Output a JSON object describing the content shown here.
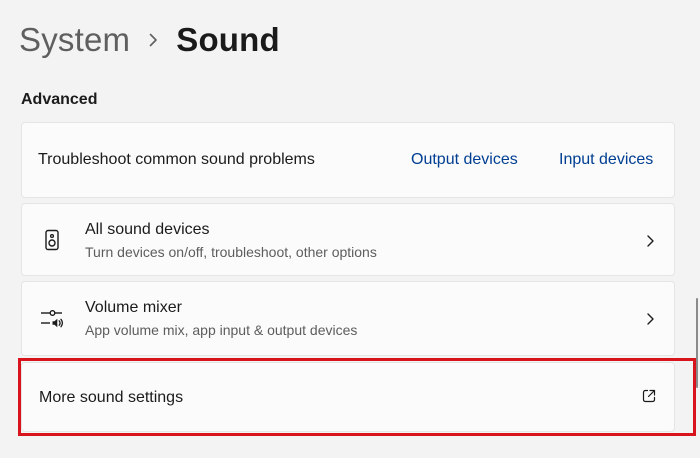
{
  "breadcrumb": {
    "parent": "System",
    "current": "Sound"
  },
  "section": {
    "title": "Advanced"
  },
  "troubleshoot": {
    "label": "Troubleshoot common sound problems",
    "output_link": "Output devices",
    "input_link": "Input devices"
  },
  "rows": [
    {
      "title": "All sound devices",
      "subtitle": "Turn devices on/off, troubleshoot, other options",
      "icon": "speaker-icon"
    },
    {
      "title": "Volume mixer",
      "subtitle": "App volume mix, app input & output devices",
      "icon": "volume-mixer-icon"
    }
  ],
  "more": {
    "label": "More sound settings",
    "icon": "external-link-icon"
  },
  "colors": {
    "background": "#f3f3f3",
    "card": "#fbfbfb",
    "link": "#003e92",
    "highlight": "#d9131c"
  }
}
